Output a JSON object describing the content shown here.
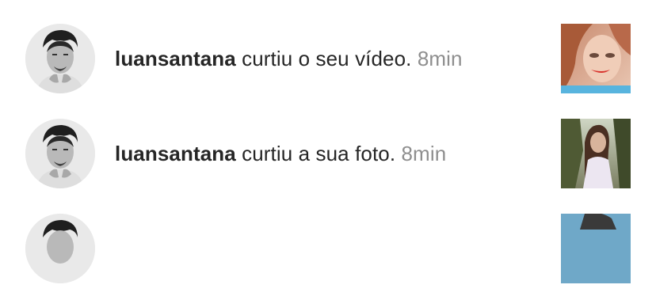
{
  "notifications": [
    {
      "username": "luansantana",
      "action": "curtiu o seu vídeo.",
      "time": "8min",
      "avatar_icon": "profile-photo",
      "thumbnail_icon": "liked-video-thumbnail"
    },
    {
      "username": "luansantana",
      "action": "curtiu a sua foto.",
      "time": "8min",
      "avatar_icon": "profile-photo",
      "thumbnail_icon": "liked-photo-thumbnail"
    },
    {
      "username": "",
      "action": "",
      "time": "",
      "avatar_icon": "profile-photo",
      "thumbnail_icon": "post-thumbnail"
    }
  ]
}
